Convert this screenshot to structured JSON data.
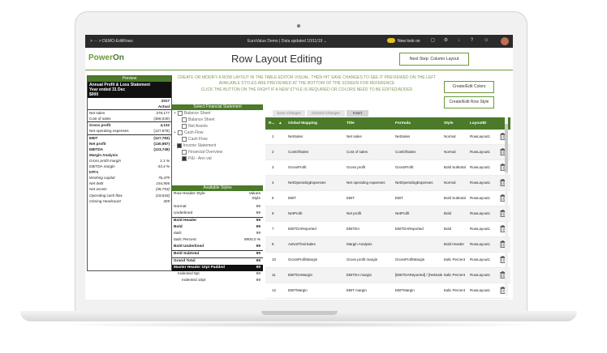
{
  "topbar": {
    "crumb": "> ··· > DEMO-EditRows",
    "center": "EuroValue Demo | Data updated 10/11/19 ⌄",
    "new_look": "New look on"
  },
  "logo": {
    "pre": "Power",
    "post": "On"
  },
  "page_title": "Row Layout Editing",
  "next_button": "Next Step: Column Layout",
  "instructions": [
    "CREATE OR MODIFY A ROW LAYOUT IN THE TABLE EDITOR VISUAL. THEN HIT SAVE CHANGES TO SEE IT PREVIEWED ON THE LEFT",
    "AVAILABLE STYLES ARE PREVIEWED AT THE BOTTOM OF THE SCREEN FOR REFERENCE",
    "CLICK THE BUTTON ON THE RIGHT IF A NEW STYLE IS REQUIRED OR COLORS NEED TO BE EDITED/ADDED"
  ],
  "side_buttons": {
    "colors": "Create/Edit Colors",
    "row_style": "Create/Edit Row Style"
  },
  "preview": {
    "header": "Preview",
    "title_lines": [
      "Annual Profit & Loss Statement",
      "Year ended 31 Dec",
      "$000"
    ],
    "col_year": "2017",
    "col_actual": "Actual",
    "rows": [
      {
        "label": "Net sales",
        "value": "379,177",
        "style": ""
      },
      {
        "label": "Cost of sales",
        "value": "(366,040)",
        "style": "ul"
      },
      {
        "label": "Gross profit",
        "value": "4,132",
        "style": "b"
      },
      {
        "label": "Net operating expenses",
        "value": "(127,878)",
        "style": "ul"
      },
      {
        "label": "EBIT",
        "value": "(127,783)",
        "style": "b"
      },
      {
        "label": "Net profit",
        "value": "(130,987)",
        "style": "b"
      },
      {
        "label": "EBITDA",
        "value": "(123,749)",
        "style": "b"
      },
      {
        "label": "Margin Analysis",
        "value": "",
        "style": "b"
      },
      {
        "label": "Gross profit margin",
        "value": "1.1 %",
        "style": "i"
      },
      {
        "label": "EBITDA margin",
        "value": "-33.4 %",
        "style": "i"
      },
      {
        "label": "KPI's",
        "value": "",
        "style": "b"
      },
      {
        "label": "Working capital",
        "value": "76,479",
        "style": "i"
      },
      {
        "label": "Net debt",
        "value": "154,906",
        "style": "i"
      },
      {
        "label": "Net assets",
        "value": "(38,753)",
        "style": "i"
      },
      {
        "label": "Operating cash flow",
        "value": "(18,843)",
        "style": "i"
      },
      {
        "label": "Closing Headcount",
        "value": "309",
        "style": "i"
      }
    ]
  },
  "statements": {
    "header": "Select Financial Statement",
    "items": [
      {
        "label": "Balance Sheet",
        "prefix": "+",
        "checked": false,
        "indent": 0
      },
      {
        "label": "Balance Sheet",
        "prefix": "",
        "checked": false,
        "indent": 1
      },
      {
        "label": "Net Assets",
        "prefix": "",
        "checked": false,
        "indent": 1
      },
      {
        "label": "Cash Flow",
        "prefix": "+",
        "checked": false,
        "indent": 0
      },
      {
        "label": "Cash Flow",
        "prefix": "",
        "checked": false,
        "indent": 1
      },
      {
        "label": "Income Statement",
        "prefix": "-",
        "checked": true,
        "indent": 0
      },
      {
        "label": "Financial Overview",
        "prefix": "",
        "checked": false,
        "indent": 1
      },
      {
        "label": "P&l - Ann val",
        "prefix": "",
        "checked": true,
        "indent": 1
      }
    ]
  },
  "styles": {
    "header": "Available Styles",
    "col_left": "Row Header Style",
    "col_right_1": "Values",
    "col_right_2": "Style",
    "rows": [
      {
        "label": "Normal",
        "value": "99",
        "style": ""
      },
      {
        "label": "Underlined",
        "value": "99",
        "style": "ul"
      },
      {
        "label": "Bold Header",
        "value": "99",
        "style": "b"
      },
      {
        "label": "Bold",
        "value": "99",
        "style": "b"
      },
      {
        "label": "Italic",
        "value": "99",
        "style": "i"
      },
      {
        "label": "Italic Percent",
        "value": "9900.0 %",
        "style": "i"
      },
      {
        "label": "Bold Underlined",
        "value": "99",
        "style": "b ul"
      },
      {
        "label": "Bold Subtotal",
        "value": "99",
        "style": "b ul"
      },
      {
        "label": "Grand Total",
        "value": "99",
        "style": "b"
      },
      {
        "label": "Master Header 10pt Padded",
        "value": "99",
        "style": "blk"
      },
      {
        "label": "Indented 5pt",
        "value": "99",
        "style": "ind1"
      },
      {
        "label": "Indented 10pt",
        "value": "99",
        "style": "ind2"
      }
    ]
  },
  "tabs": [
    "Save Changes",
    "Discard Changes",
    "Insert"
  ],
  "grid": {
    "headers": [
      "R...",
      "▲",
      "Global Mapping",
      "Title",
      "Formula",
      "Style",
      "LayoutID"
    ],
    "rows": [
      {
        "n": "1",
        "map": "NetSales",
        "title": "Net sales",
        "formula": "NetSales",
        "style": "Normal",
        "layout": "RowLayout1"
      },
      {
        "n": "2",
        "map": "CostOfSales",
        "title": "Cost of sales",
        "formula": "CostOfSales",
        "style": "Normal",
        "layout": "RowLayout1"
      },
      {
        "n": "3",
        "map": "GrossProfit",
        "title": "Gross profit",
        "formula": "GrossProfit",
        "style": "Bold Subtotal",
        "layout": "RowLayout1"
      },
      {
        "n": "4",
        "map": "NetOperatingExpenses",
        "title": "Net operating expenses",
        "formula": "NetOperatingExpenses",
        "style": "Normal",
        "layout": "RowLayout1"
      },
      {
        "n": "5",
        "map": "EBIT",
        "title": "EBIT",
        "formula": "EBIT",
        "style": "Bold Subtotal",
        "layout": "RowLayout1"
      },
      {
        "n": "6",
        "map": "NetProfit",
        "title": "Net profit",
        "formula": "NetProfit",
        "style": "Bold",
        "layout": "RowLayout1"
      },
      {
        "n": "7",
        "map": "EBITDAReported",
        "title": "EBITDA",
        "formula": "EBITDAReported",
        "style": "Bold",
        "layout": "RowLayout1"
      },
      {
        "n": "8",
        "map": "AsNotTheirSales",
        "title": "Margin Analysis",
        "formula": "",
        "style": "Bold Header",
        "layout": "RowLayout1"
      },
      {
        "n": "10",
        "map": "GrossProfitMargin",
        "title": "Gross profit margin",
        "formula": "GrossProfitMargin",
        "style": "Italic Percent",
        "layout": "RowLayout1"
      },
      {
        "n": "11",
        "map": "EBITDAMargin",
        "title": "EBITDA margin",
        "formula": "[EBITDAReported] / [NetSales]",
        "style": "Italic Percent",
        "layout": "RowLayout1"
      },
      {
        "n": "12",
        "map": "EBITMargin",
        "title": "EBIT margin",
        "formula": "EBITMargin",
        "style": "Italic Percent",
        "layout": "RowLayout1"
      }
    ]
  }
}
